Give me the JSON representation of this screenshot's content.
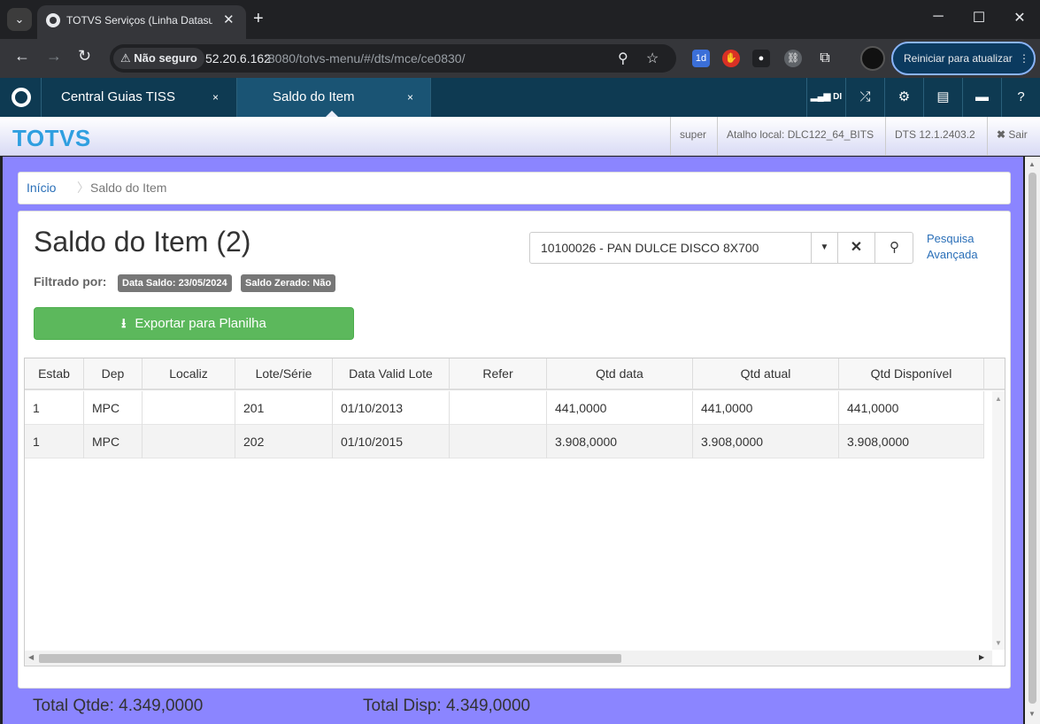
{
  "browser": {
    "tab_title": "TOTVS Serviços (Linha Datasul) - TOTVS",
    "close_glyph": "✕",
    "new_tab_glyph": "+",
    "menu_glyph": "⌄",
    "insecure_label": "Não seguro",
    "url_host": "52.20.6.162",
    "url_rest": ":8080/totvs-menu/#/dts/mce/ce0830/",
    "relaunch_label": "Reiniciar para atualizar",
    "ext_badge": "1d"
  },
  "app": {
    "tabs": [
      {
        "label": "Central Guias TISS"
      },
      {
        "label": "Saldo do Item"
      }
    ],
    "tab_close": "×",
    "di_label": "DI"
  },
  "header": {
    "brand": "TOTVS",
    "user": "super",
    "shortcut": "Atalho local: DLC122_64_BITS",
    "version": "DTS 12.1.2403.2",
    "logout": "Sair"
  },
  "breadcrumb": {
    "home": "Início",
    "current": "Saldo do Item"
  },
  "page": {
    "title": "Saldo do Item (2)",
    "filter_label": "Filtrado por:",
    "filters": [
      "Data Saldo: 23/05/2024",
      "Saldo Zerado: Não"
    ],
    "export_label": "Exportar para Planilha",
    "search_value": "10100026 - PAN DULCE DISCO 8X700",
    "advanced_search": "Pesquisa Avançada"
  },
  "grid": {
    "columns": [
      "Estab",
      "Dep",
      "Localiz",
      "Lote/Série",
      "Data Valid Lote",
      "Refer",
      "Qtd data",
      "Qtd atual",
      "Qtd Disponível"
    ],
    "rows": [
      [
        "1",
        "MPC",
        "",
        "201",
        "01/10/2013",
        "",
        "441,0000",
        "441,0000",
        "441,0000"
      ],
      [
        "1",
        "MPC",
        "",
        "202",
        "01/10/2015",
        "",
        "3.908,0000",
        "3.908,0000",
        "3.908,0000"
      ]
    ]
  },
  "totals": {
    "qtde": "Total Qtde: 4.349,0000",
    "disp": "Total Disp: 4.349,0000"
  },
  "colors": {
    "app_bar": "#0e3a52",
    "brand": "#2f9fe0",
    "content_bg": "#8b85ff",
    "export_green": "#5cb85c",
    "link": "#2a6fb8"
  }
}
